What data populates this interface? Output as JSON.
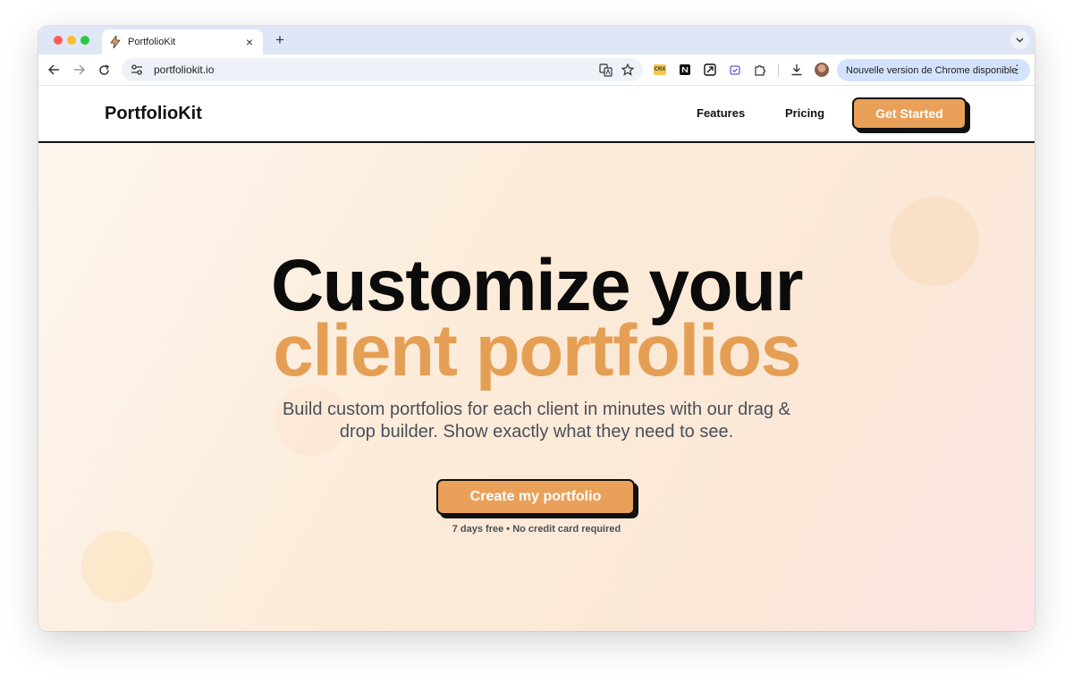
{
  "browser": {
    "tab_title": "PortfolioKit",
    "url": "portfoliokit.io",
    "update_notice": "Nouvelle version de Chrome disponible",
    "extension_crx_label": "CRX"
  },
  "site": {
    "logo": "PortfolioKit",
    "nav": {
      "features": "Features",
      "pricing": "Pricing",
      "get_started": "Get Started"
    },
    "hero": {
      "headline_line1": "Customize your",
      "headline_line2": "client portfolios",
      "subtitle": "Build custom portfolios for each client in minutes with our drag & drop builder. Show exactly what they need to see.",
      "cta_label": "Create my portfolio",
      "cta_note": "7 days free • No credit card required"
    }
  },
  "colors": {
    "accent": "#e9a059",
    "headline_accent": "#e59f55",
    "text_dark": "#0b0b0b",
    "text_muted": "#4a4f5a"
  }
}
